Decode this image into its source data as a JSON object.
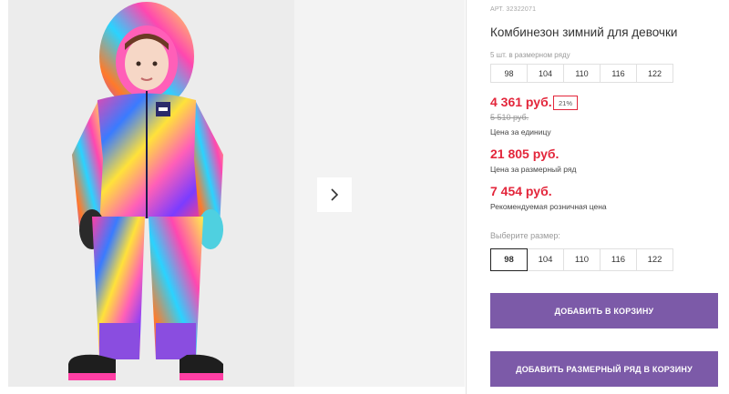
{
  "product": {
    "article": "АРТ. 32322071",
    "title": "Комбинезон зимний для девочки",
    "series_label": "5 шт. в размерном ряду",
    "series_sizes": [
      "98",
      "104",
      "110",
      "116",
      "122"
    ],
    "price": "4 361 руб.",
    "discount": "21%",
    "old_price": "5 510 руб.",
    "price_unit_label": "Цена за единицу",
    "series_price": "21 805 руб.",
    "series_price_label": "Цена за размерный ряд",
    "retail_price": "7 454 руб.",
    "retail_price_label": "Рекомендуемая розничная цена",
    "choose_size_label": "Выберите размер:",
    "pick_sizes": [
      "98",
      "104",
      "110",
      "116",
      "122"
    ],
    "selected_size": "98",
    "add_to_cart": "ДОБАВИТЬ В КОРЗИНУ",
    "add_series_to_cart": "ДОБАВИТЬ РАЗМЕРНЫЙ РЯД В КОРЗИНУ"
  },
  "gallery": {
    "next_icon": "chevron-right-icon"
  },
  "colors": {
    "price_red": "#e3263b",
    "button_purple": "#7c5aa8"
  }
}
